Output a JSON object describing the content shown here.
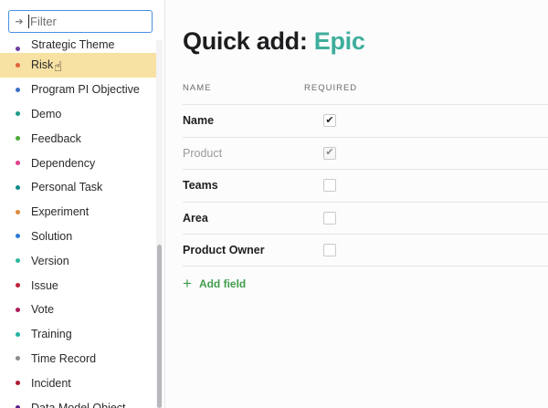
{
  "filter": {
    "placeholder": "Filter",
    "icon": "arrow-right-icon"
  },
  "types": [
    {
      "label": "Strategic Theme",
      "color": "#6b3fa0"
    },
    {
      "label": "Risk",
      "color": "#e0623a",
      "selected": true
    },
    {
      "label": "Program PI Objective",
      "color": "#3a6fc4"
    },
    {
      "label": "Demo",
      "color": "#1d9a8c"
    },
    {
      "label": "Feedback",
      "color": "#4aa83a"
    },
    {
      "label": "Dependency",
      "color": "#e23d8a"
    },
    {
      "label": "Personal Task",
      "color": "#0f8a8a"
    },
    {
      "label": "Experiment",
      "color": "#e08a3a"
    },
    {
      "label": "Solution",
      "color": "#2d79d6"
    },
    {
      "label": "Version",
      "color": "#2bb5a0"
    },
    {
      "label": "Issue",
      "color": "#c21f3a"
    },
    {
      "label": "Vote",
      "color": "#b0185a"
    },
    {
      "label": "Training",
      "color": "#1fb3a8"
    },
    {
      "label": "Time Record",
      "color": "#8c8c8c"
    },
    {
      "label": "Incident",
      "color": "#b01830"
    },
    {
      "label": "Data Model Object",
      "color": "#5a1e8c"
    }
  ],
  "quick_add": {
    "prefix": "Quick add: ",
    "entity": "Epic"
  },
  "columns": {
    "name": "NAME",
    "required": "REQUIRED"
  },
  "fields": [
    {
      "name": "Name",
      "required": true,
      "disabled": false
    },
    {
      "name": "Product",
      "required": true,
      "disabled": true
    },
    {
      "name": "Teams",
      "required": false,
      "disabled": false
    },
    {
      "name": "Area",
      "required": false,
      "disabled": false
    },
    {
      "name": "Product Owner",
      "required": false,
      "disabled": false
    }
  ],
  "add_field": {
    "label": "Add field",
    "icon": "plus-icon"
  },
  "colors": {
    "accent": "#3fae9c",
    "selected_bg": "#f7e1a3",
    "add_green": "#3f9d4a",
    "focus": "#4a90e2"
  }
}
